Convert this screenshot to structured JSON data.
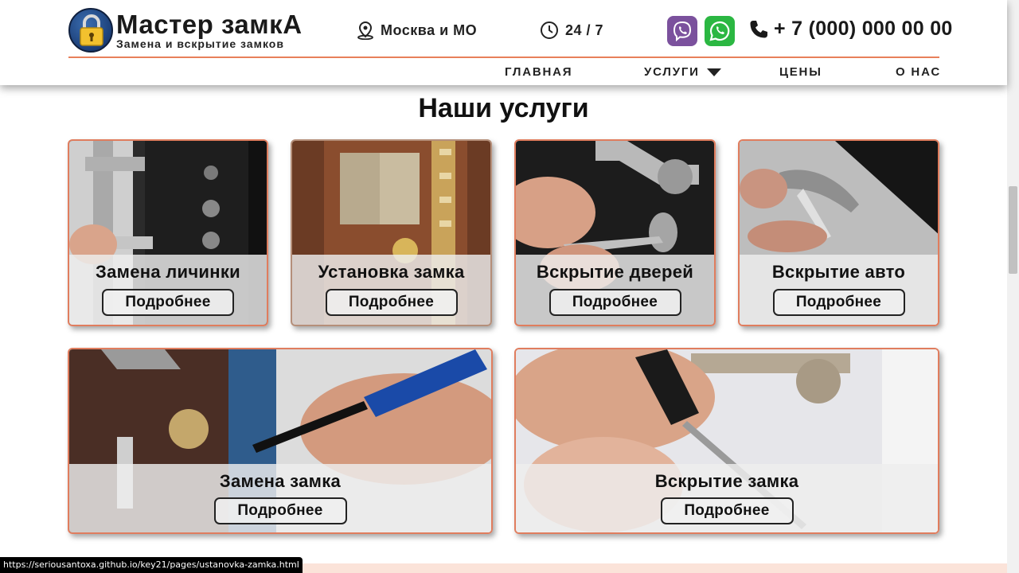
{
  "header": {
    "logo_title": "Мастер замкА",
    "logo_subtitle": "Замена и вскрытие замков",
    "location": "Москва и МО",
    "hours": "24 / 7",
    "phone": "+ 7 (000) 000 00 00"
  },
  "nav": {
    "items": [
      {
        "label": "ГЛАВНАЯ"
      },
      {
        "label": "УСЛУГИ"
      },
      {
        "label": "ЦЕНЫ"
      },
      {
        "label": "О НАС"
      }
    ]
  },
  "services": {
    "title": "Наши услуги",
    "button_label": "Подробнее",
    "cards": [
      {
        "title": "Замена личинки"
      },
      {
        "title": "Установка замка"
      },
      {
        "title": "Вскрытие дверей"
      },
      {
        "title": "Вскрытие авто"
      },
      {
        "title": "Замена замка"
      },
      {
        "title": "Вскрытие замка"
      }
    ]
  },
  "statusbar": {
    "url": "https://seriousantoxa.github.io/key21/pages/ustanovka-zamka.html"
  },
  "colors": {
    "accent": "#e07d5e",
    "viber": "#7b519d",
    "whatsapp": "#2bb742"
  }
}
